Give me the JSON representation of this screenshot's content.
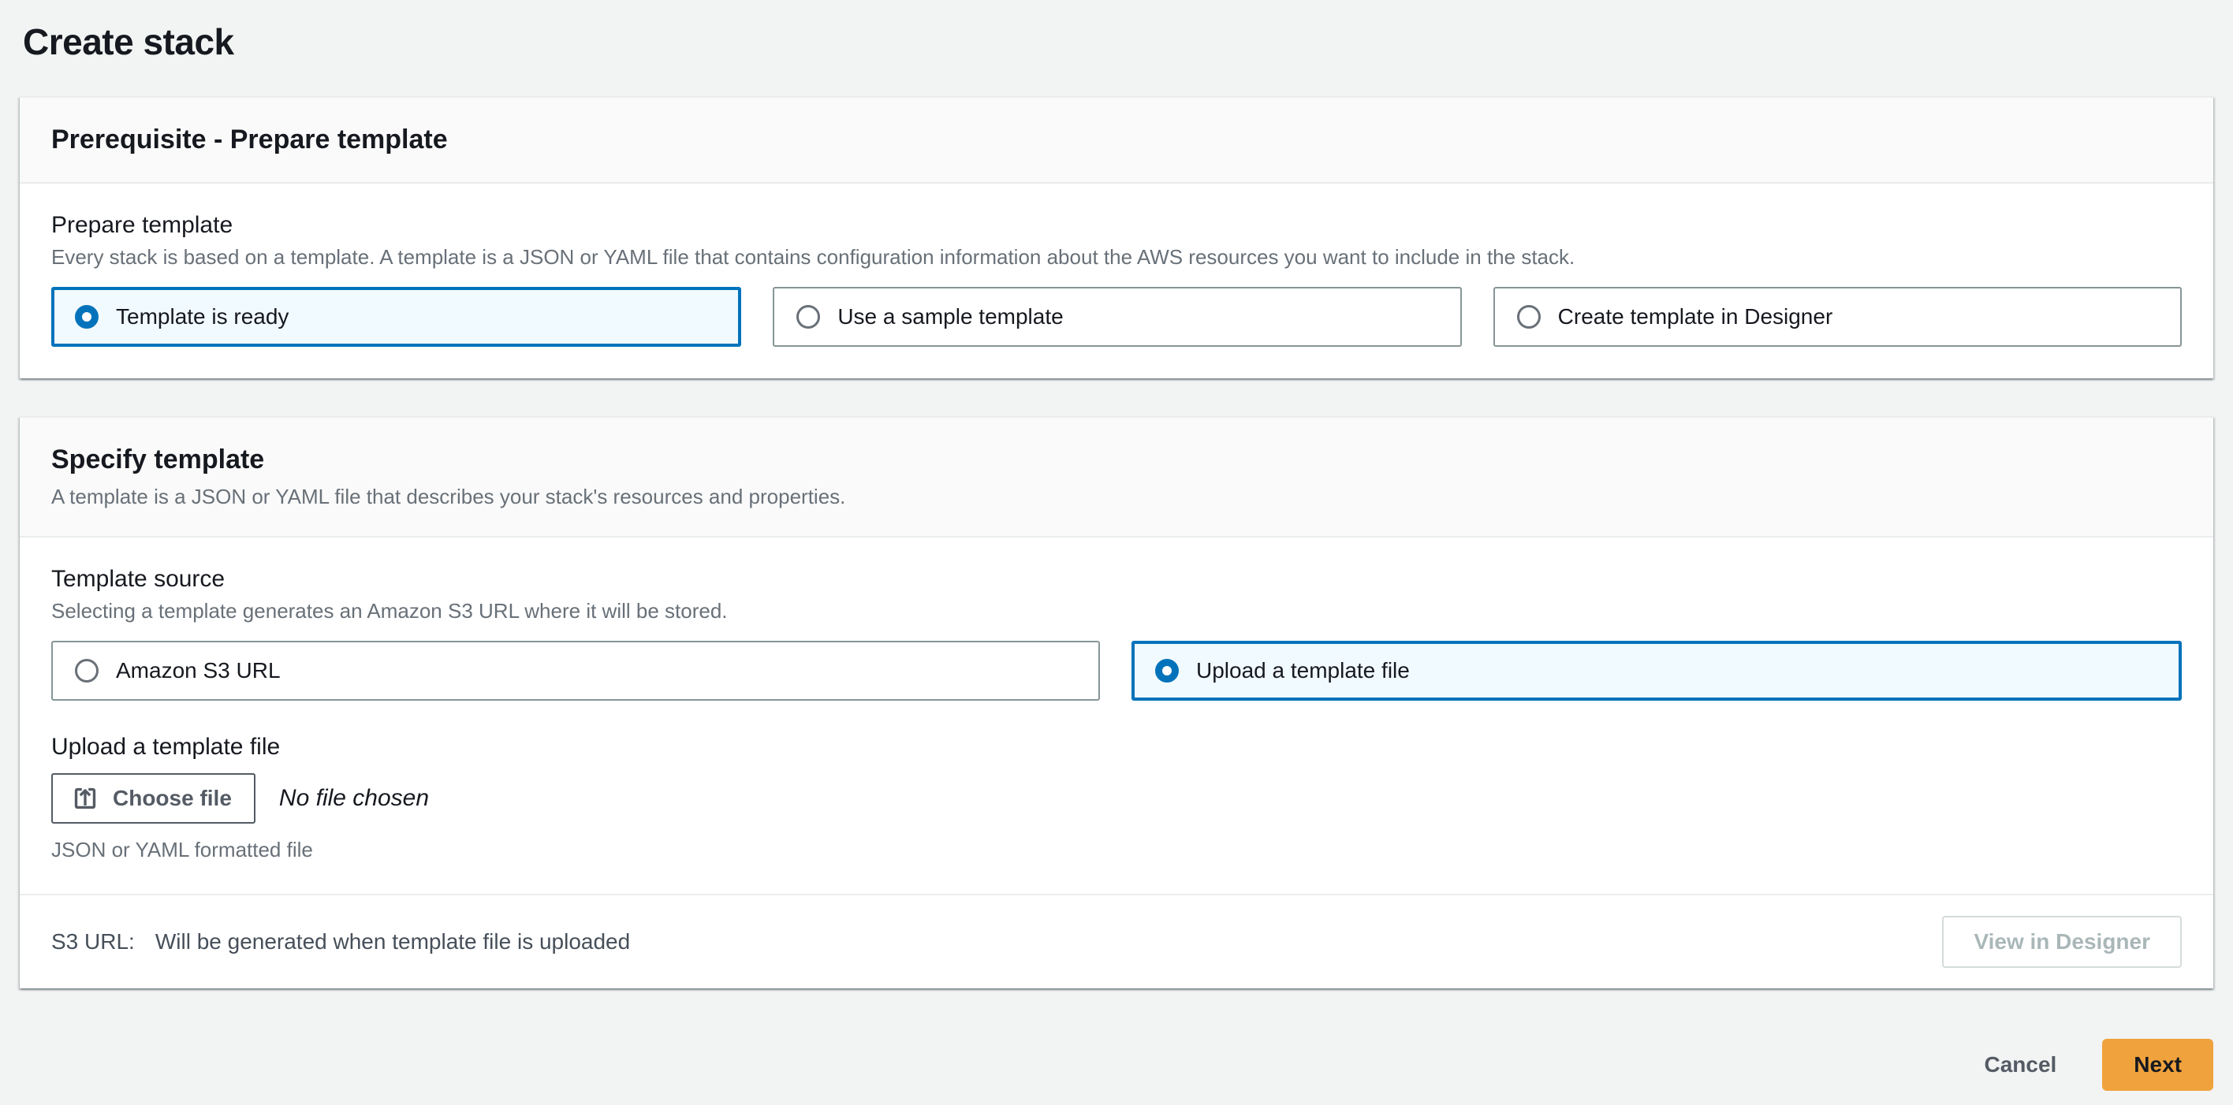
{
  "page": {
    "title": "Create stack"
  },
  "colors": {
    "page_background": "#f2f3f3",
    "accent_blue": "#0073bb",
    "selected_tile_background": "#f1faff",
    "primary_button_orange": "#f0a23c",
    "disabled_text": "#aab7b8",
    "secondary_text": "#687078"
  },
  "prerequisite_card": {
    "header": "Prerequisite - Prepare template",
    "field_label": "Prepare template",
    "field_description": "Every stack is based on a template. A template is a JSON or YAML file that contains configuration information about the AWS resources you want to include in the stack.",
    "options": [
      {
        "label": "Template is ready",
        "selected": true
      },
      {
        "label": "Use a sample template",
        "selected": false
      },
      {
        "label": "Create template in Designer",
        "selected": false
      }
    ]
  },
  "specify_card": {
    "header": "Specify template",
    "header_description": "A template is a JSON or YAML file that describes your stack's resources and properties.",
    "source_label": "Template source",
    "source_description": "Selecting a template generates an Amazon S3 URL where it will be stored.",
    "source_options": [
      {
        "label": "Amazon S3 URL",
        "selected": false
      },
      {
        "label": "Upload a template file",
        "selected": true
      }
    ],
    "upload_label": "Upload a template file",
    "choose_file_button": "Choose file",
    "no_file_text": "No file chosen",
    "file_hint": "JSON or YAML formatted file",
    "s3_url_label": "S3 URL:",
    "s3_url_value": "Will be generated when template file is uploaded",
    "view_designer_button": "View in Designer"
  },
  "actions": {
    "cancel": "Cancel",
    "next": "Next"
  }
}
